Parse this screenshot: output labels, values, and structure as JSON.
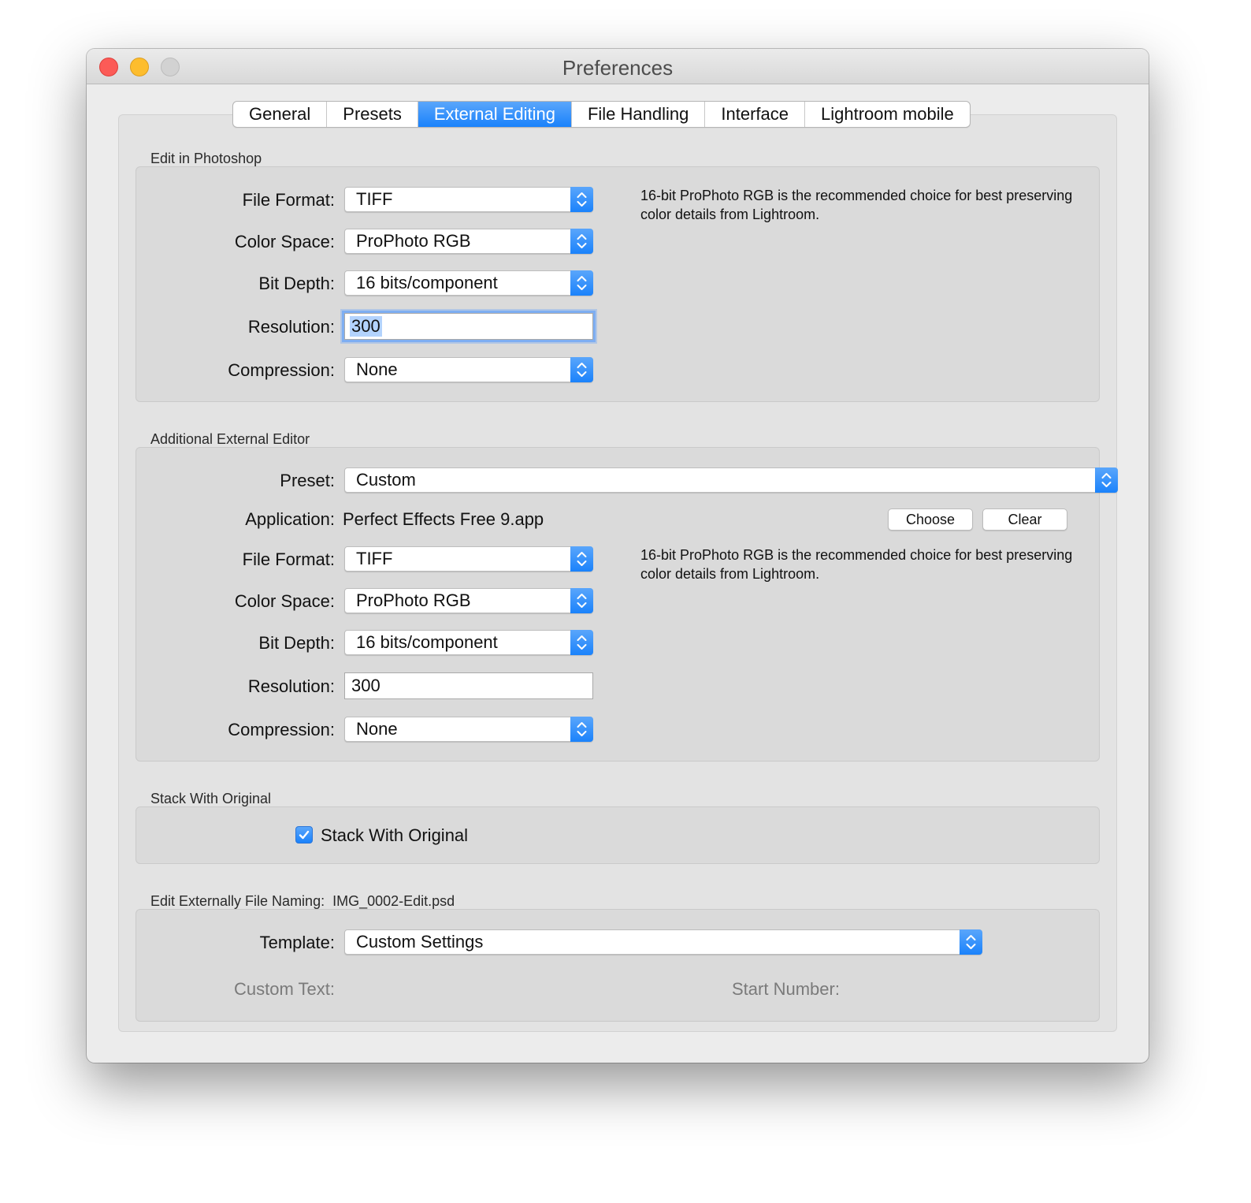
{
  "window": {
    "title": "Preferences"
  },
  "tabs": [
    {
      "label": "General",
      "active": false
    },
    {
      "label": "Presets",
      "active": false
    },
    {
      "label": "External Editing",
      "active": true
    },
    {
      "label": "File Handling",
      "active": false
    },
    {
      "label": "Interface",
      "active": false
    },
    {
      "label": "Lightroom mobile",
      "active": false
    }
  ],
  "photoshop": {
    "section_label": "Edit in Photoshop",
    "file_format_label": "File Format:",
    "file_format": "TIFF",
    "color_space_label": "Color Space:",
    "color_space": "ProPhoto RGB",
    "bit_depth_label": "Bit Depth:",
    "bit_depth": "16 bits/component",
    "resolution_label": "Resolution:",
    "resolution": "300",
    "compression_label": "Compression:",
    "compression": "None",
    "hint": "16-bit ProPhoto RGB is the recommended choice for best preserving color details from Lightroom."
  },
  "external": {
    "section_label": "Additional External Editor",
    "preset_label": "Preset:",
    "preset": "Custom",
    "application_label": "Application:",
    "application": "Perfect Effects Free 9.app",
    "choose_label": "Choose",
    "clear_label": "Clear",
    "file_format_label": "File Format:",
    "file_format": "TIFF",
    "color_space_label": "Color Space:",
    "color_space": "ProPhoto RGB",
    "bit_depth_label": "Bit Depth:",
    "bit_depth": "16 bits/component",
    "resolution_label": "Resolution:",
    "resolution": "300",
    "compression_label": "Compression:",
    "compression": "None",
    "hint": "16-bit ProPhoto RGB is the recommended choice for best preserving color details from Lightroom."
  },
  "stack": {
    "section_label": "Stack With Original",
    "checkbox_label": "Stack With Original",
    "checked": true
  },
  "naming": {
    "section_label": "Edit Externally File Naming:",
    "example": "IMG_0002-Edit.psd",
    "template_label": "Template:",
    "template": "Custom Settings",
    "custom_text_label": "Custom Text:",
    "start_number_label": "Start Number:"
  },
  "colors": {
    "accent": "#1a82fb",
    "close": "#fc5b57",
    "minimize": "#fdbd2e",
    "zoom": "#d2d2d2"
  },
  "icons": {
    "stepper": "up-down-chevron-icon",
    "check": "checkmark-icon"
  }
}
